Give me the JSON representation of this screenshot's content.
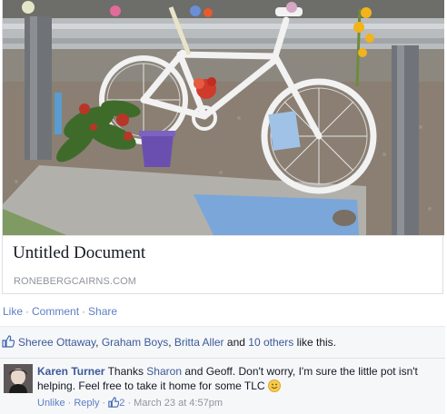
{
  "link_preview": {
    "title": "Untitled Document",
    "domain": "RONEBERGCAIRNS.COM"
  },
  "actions": {
    "like": "Like",
    "comment": "Comment",
    "share": "Share",
    "separator": "·"
  },
  "likes": {
    "names": [
      "Sheree Ottaway",
      "Graham Boys",
      "Britta Aller"
    ],
    "others": "10 others",
    "and_text": "and",
    "suffix": "like this."
  },
  "comment": {
    "author": "Karen Turner",
    "text_1": "Thanks",
    "mention": "Sharon",
    "text_2": "and Geoff. Don't worry, I'm sure the little pot isn't helping. Feel free to take it home for some TLC",
    "unlike": "Unlike",
    "reply": "Reply",
    "like_count": "2",
    "timestamp": "March 23 at 4:57pm"
  },
  "colors": {
    "link": "#3b5998",
    "action_link": "#5b7ec6",
    "muted": "#90949c",
    "bike_white": "#f2f2f2",
    "flower_red": "#d03a2a"
  }
}
